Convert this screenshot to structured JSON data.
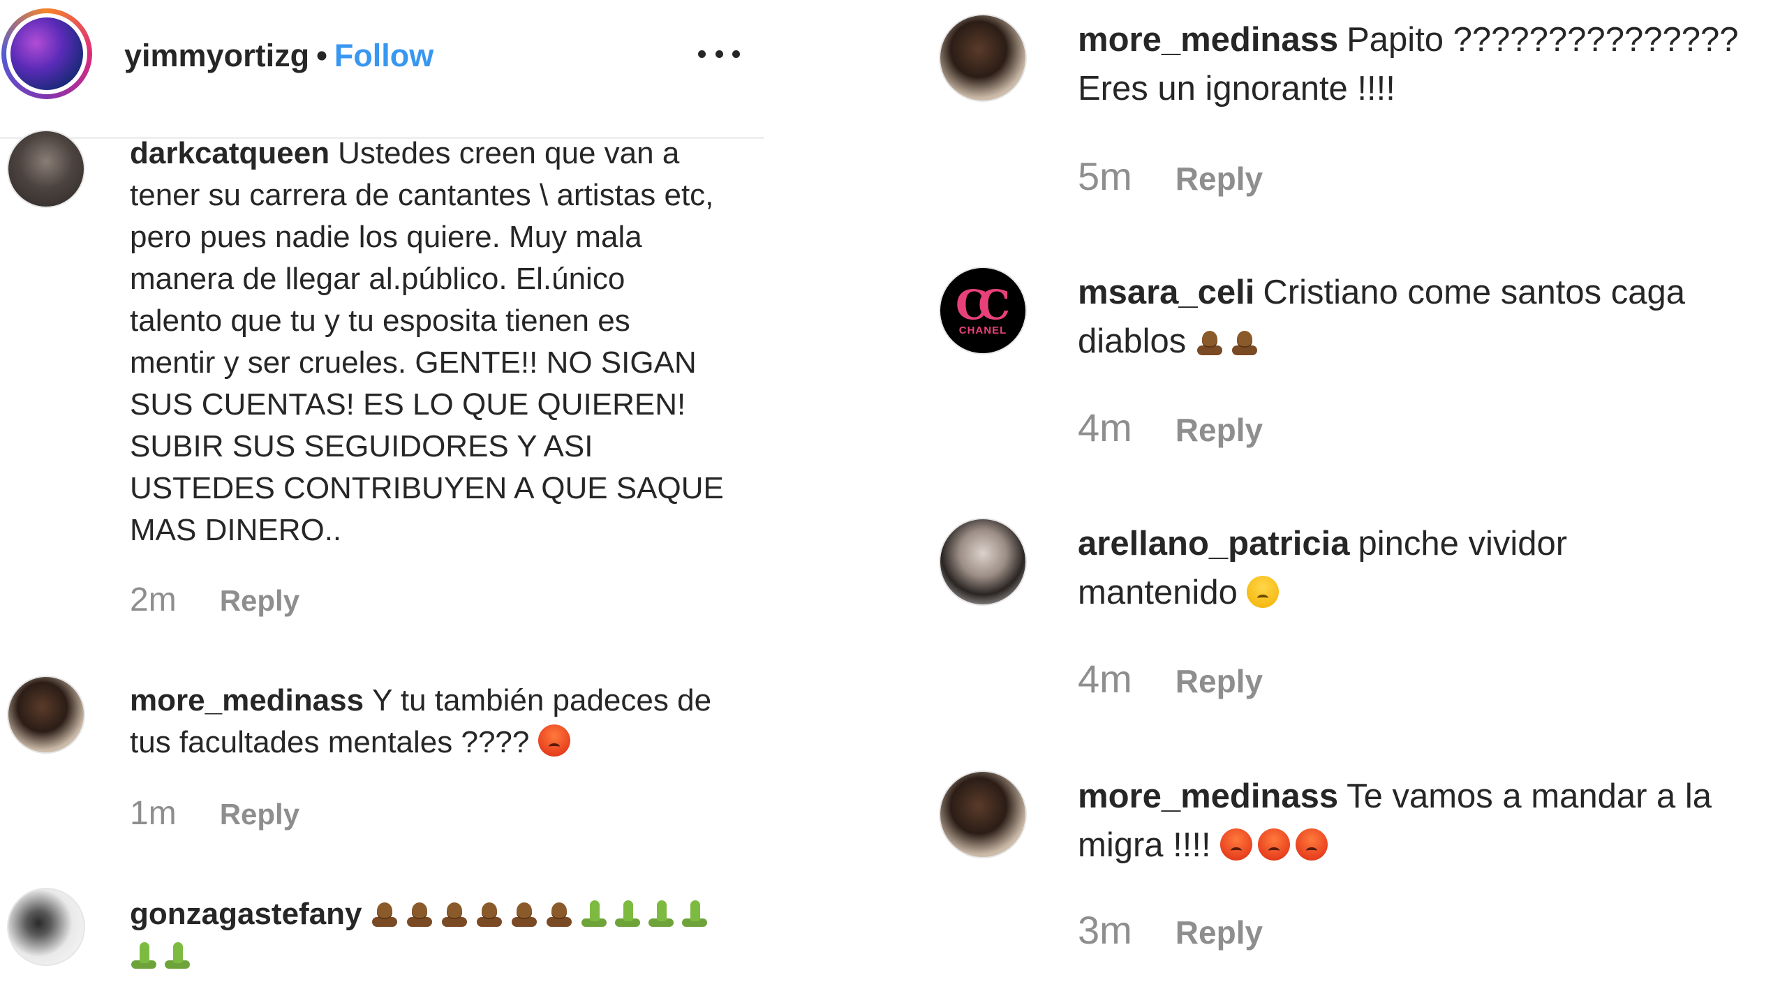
{
  "header": {
    "username": "yimmyortizg",
    "separator": "•",
    "follow_label": "Follow",
    "more_icon": "more-horizontal-icon"
  },
  "left_comments": [
    {
      "username": "darkcatqueen",
      "lines": [
        "Ustedes creen que van a",
        "tener su carrera de cantantes \\ artistas etc,",
        "pero pues nadie los quiere. Muy mala",
        "manera de llegar al.público. El.único",
        "talento que tu y tu esposita tienen es",
        "mentir y ser crueles. GENTE!! NO SIGAN",
        "SUS CUENTAS! ES LO QUE QUIEREN!",
        "SUBIR SUS SEGUIDORES Y ASI",
        "USTEDES CONTRIBUYEN A QUE SAQUE",
        "MAS DINERO.."
      ],
      "time": "2m",
      "reply_label": "Reply"
    },
    {
      "username": "more_medinass",
      "lines": [
        "Y tu también padeces de",
        "tus facultades mentales ????"
      ],
      "time": "1m",
      "reply_label": "Reply"
    },
    {
      "username": "gonzagastefany",
      "emoji_line_1": [
        "poo",
        "poo",
        "poo",
        "poo",
        "poo",
        "poo",
        "snake",
        "snake",
        "snake",
        "snake"
      ],
      "emoji_line_2": [
        "snake",
        "snake"
      ]
    }
  ],
  "right_comments": [
    {
      "username": "more_medinass",
      "lines": [
        "Papito ???????????????",
        "Eres un ignorante !!!!"
      ],
      "time": "5m",
      "reply_label": "Reply"
    },
    {
      "username": "msara_celi",
      "lines": [
        "Cristiano come santos caga",
        "diablos"
      ],
      "avatar_text": "CHANEL",
      "time": "4m",
      "reply_label": "Reply"
    },
    {
      "username": "arellano_patricia",
      "lines": [
        "pinche vividor",
        "mantenido"
      ],
      "time": "4m",
      "reply_label": "Reply"
    },
    {
      "username": "more_medinass",
      "lines": [
        "Te vamos a mandar a la",
        "migra !!!!"
      ],
      "time": "3m",
      "reply_label": "Reply"
    }
  ],
  "colors": {
    "text": "#262626",
    "muted": "#8e8e8e",
    "follow_blue": "#3897f0",
    "divider": "#efefef"
  }
}
